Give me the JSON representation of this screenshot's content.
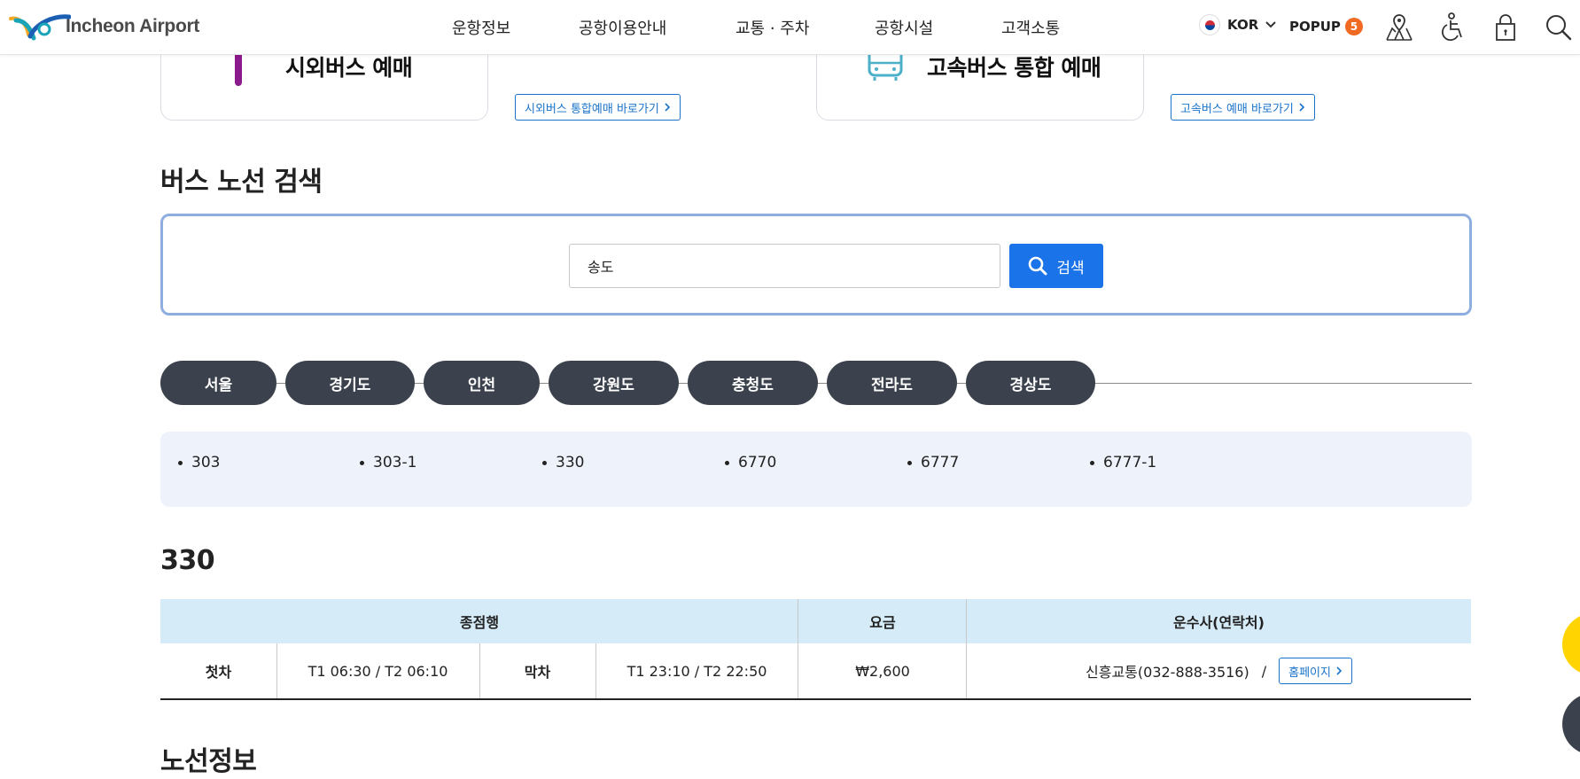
{
  "header": {
    "logo_text": "Incheon Airport",
    "nav": [
      "운항정보",
      "공항이용안내",
      "교통 · 주차",
      "공항시설",
      "고객소통"
    ],
    "language": "KOR",
    "popup_label": "POPUP",
    "popup_count": "5",
    "icons": [
      "map-icon",
      "accessibility-icon",
      "lock-icon",
      "search-icon"
    ]
  },
  "cards": [
    {
      "title": "시외버스 예매",
      "link_label": "시외버스 통합예매 바로가기"
    },
    {
      "title": "고속버스 통합 예매",
      "link_label": "고속버스 예매 바로가기"
    }
  ],
  "search_section": {
    "title": "버스 노선 검색",
    "input_value": "송도",
    "button_label": "검색"
  },
  "regions": [
    "서울",
    "경기도",
    "인천",
    "강원도",
    "충청도",
    "전라도",
    "경상도"
  ],
  "routes": [
    "303",
    "303-1",
    "330",
    "6770",
    "6777",
    "6777-1"
  ],
  "route_detail": {
    "title": "330",
    "headers": {
      "terminal": "종점행",
      "fare": "요금",
      "operator": "운수사(연락처)"
    },
    "row": {
      "first_label": "첫차",
      "first_time": "T1 06:30 / T2 06:10",
      "last_label": "막차",
      "last_time": "T1 23:10 / T2 22:50",
      "fare": "₩2,600",
      "operator": "신흥교통(032-888-3516)",
      "separator": "/",
      "homepage_label": "홈페이지"
    }
  },
  "route_info_title": "노선정보",
  "colors": {
    "accent": "#1a73e8",
    "tab_bg": "#3c424d",
    "route_list_bg": "#eef3fb",
    "table_head_bg": "#d6ebf8",
    "popup_badge": "#f06a22",
    "card_bar": "#8b1a8c"
  }
}
